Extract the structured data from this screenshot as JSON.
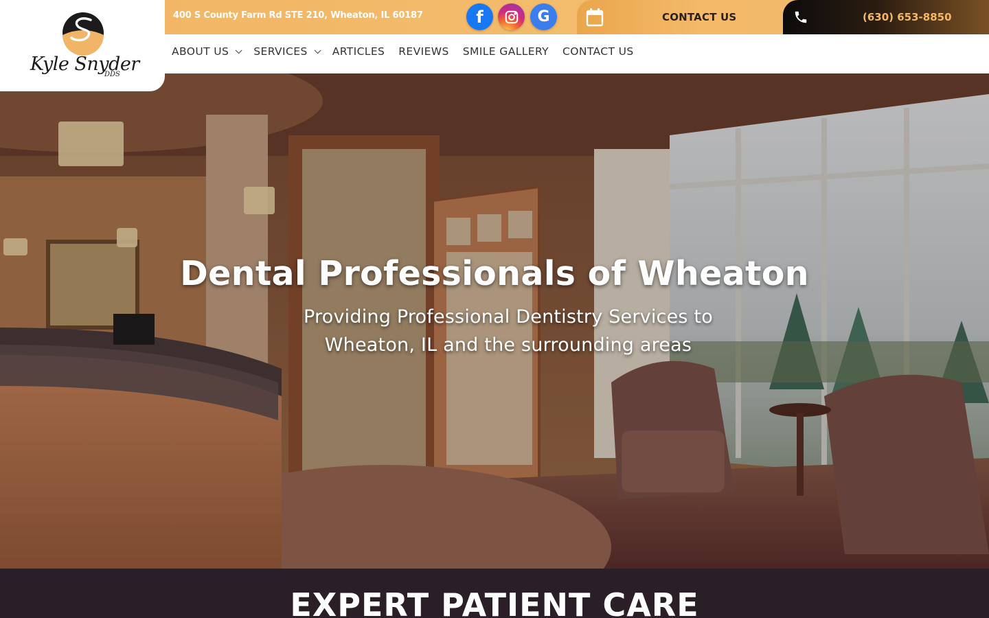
{
  "topbar": {
    "address": "400 S County Farm Rd STE 210, Wheaton, IL 60187",
    "social": [
      {
        "name": "facebook-icon",
        "glyph": "f"
      },
      {
        "name": "instagram-icon",
        "glyph": ""
      },
      {
        "name": "google-icon",
        "glyph": "G"
      }
    ],
    "contact_label": "CONTACT US",
    "phone": "(630) 653-8850"
  },
  "logo": {
    "name": "Kyle Snyder",
    "suffix": "DDS"
  },
  "nav": {
    "items": [
      {
        "label": "ABOUT US",
        "has_dropdown": true
      },
      {
        "label": "SERVICES",
        "has_dropdown": true
      },
      {
        "label": "ARTICLES",
        "has_dropdown": false
      },
      {
        "label": "REVIEWS",
        "has_dropdown": false
      },
      {
        "label": "SMILE GALLERY",
        "has_dropdown": false
      },
      {
        "label": "CONTACT US",
        "has_dropdown": false
      }
    ]
  },
  "hero": {
    "title": "Dental Professionals of Wheaton",
    "subtitle": "Providing Professional Dentistry Services to Wheaton, IL and the surrounding areas"
  },
  "section": {
    "title": "EXPERT PATIENT CARE"
  },
  "colors": {
    "accent": "#f3b96a",
    "dark": "#2a1f26",
    "facebook": "#1877f2",
    "google": "#3b7ded"
  }
}
